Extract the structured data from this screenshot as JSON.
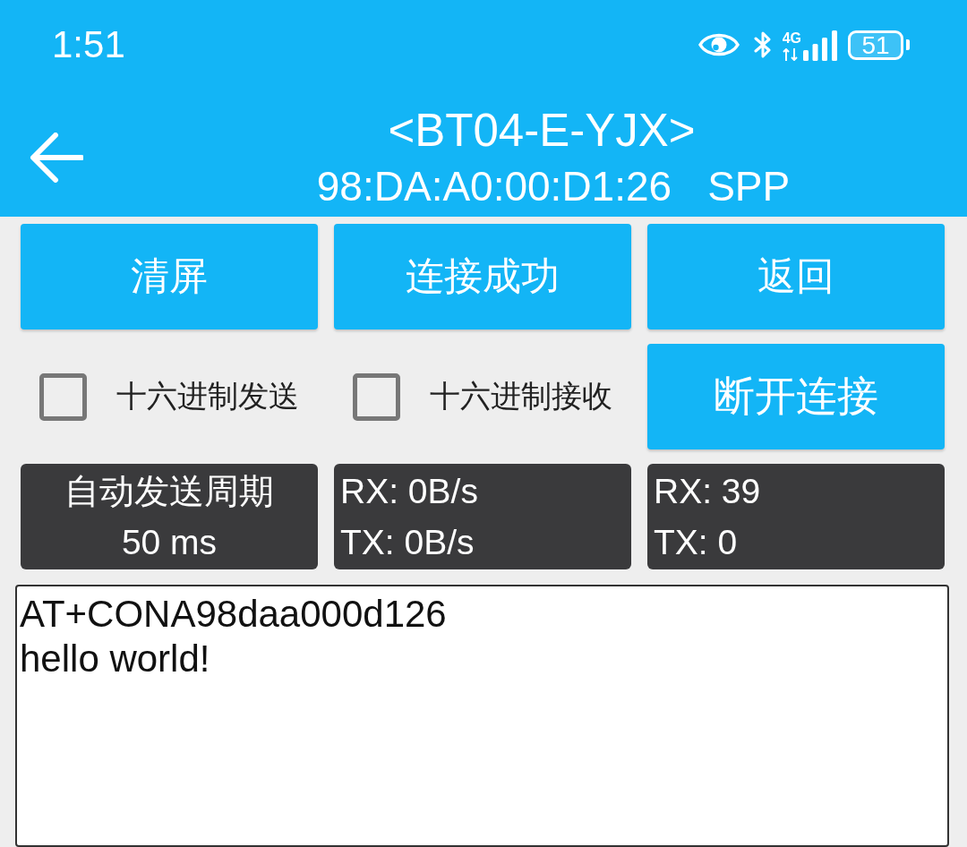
{
  "status_bar": {
    "time": "1:51",
    "network": "4G",
    "battery": "51"
  },
  "toolbar": {
    "title": "<BT04-E-YJX>",
    "address": "98:DA:A0:00:D1:26",
    "profile": "SPP"
  },
  "buttons": [
    "清屏",
    "连接成功",
    "返回"
  ],
  "options": [
    {
      "label": "十六进制发送",
      "checked": false
    },
    {
      "label": "十六进制接收",
      "checked": false
    }
  ],
  "disconnect_button": "断开连接",
  "stats": [
    {
      "kind": "setting",
      "lines": [
        "自动发送周期",
        "50 ms"
      ]
    },
    {
      "kind": "counter",
      "lines": [
        "RX: 0B/s",
        "TX: 0B/s"
      ]
    },
    {
      "kind": "counter",
      "lines": [
        "RX: 39",
        "TX: 0"
      ]
    }
  ],
  "receive_log": {
    "lines": [
      "AT+CONA98daa000d126",
      "hello world!"
    ]
  }
}
